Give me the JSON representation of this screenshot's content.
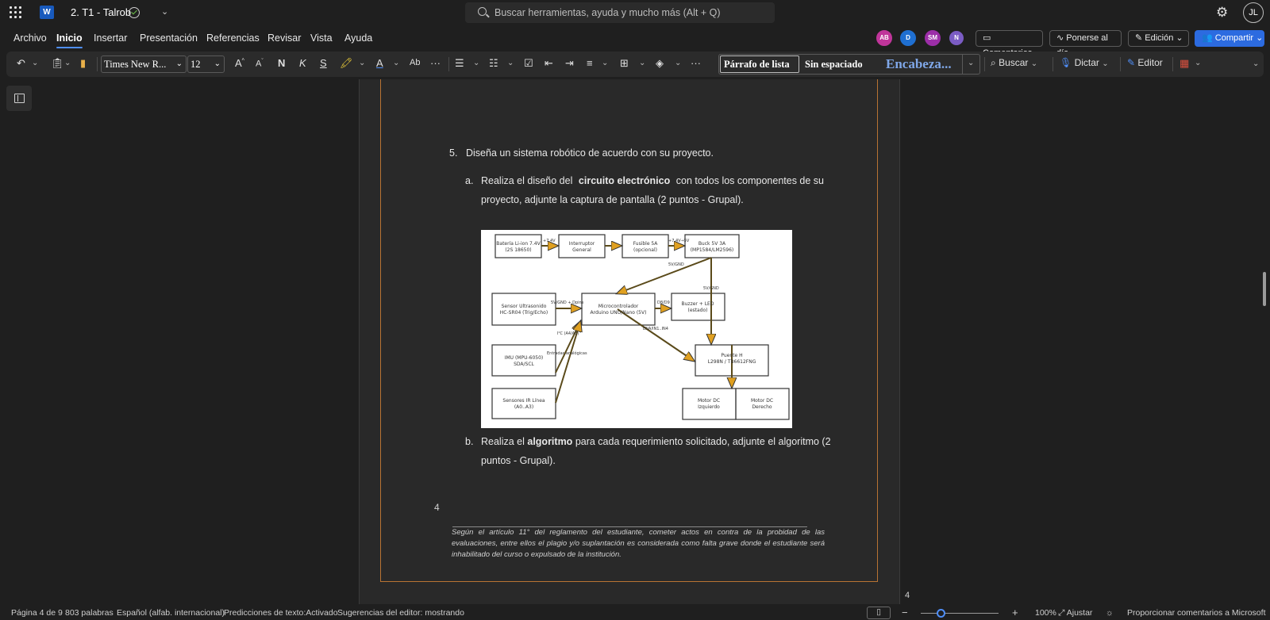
{
  "titlebar": {
    "doc_title": "2. T1 - Talrob",
    "search_placeholder": "Buscar herramientas, ayuda y mucho más (Alt + Q)",
    "user_initials": "JL"
  },
  "menu": {
    "items": [
      "Archivo",
      "Inicio",
      "Insertar",
      "Presentación",
      "Referencias",
      "Revisar",
      "Vista",
      "Ayuda"
    ],
    "active": "Inicio"
  },
  "presence": [
    {
      "initials": "AB",
      "color": "#c0359a"
    },
    {
      "initials": "D",
      "color": "#1f6fd1"
    },
    {
      "initials": "SM",
      "color": "#9c2ea8"
    },
    {
      "initials": "N",
      "color": "#7b5cc4"
    }
  ],
  "header_buttons": {
    "comments": "Comentarios",
    "catch_up": "Ponerse al día",
    "editing": "Edición",
    "share": "Compartir"
  },
  "ribbon": {
    "font_name": "Times New R...",
    "font_size": "12",
    "bold": "N",
    "italic": "K",
    "underline": "S",
    "styles": [
      "Párrafo de lista",
      "Sin espaciado",
      "Encabeza..."
    ],
    "find": "Buscar",
    "dictate": "Dictar",
    "editor": "Editor"
  },
  "document": {
    "q5": "Diseña un sistema robótico de acuerdo con su proyecto.",
    "q5_num": "5.",
    "qa_label": "a.",
    "qa_pre": "Realiza el diseño del",
    "qa_bold": "circuito electrónico",
    "qa_post": "con todos los componentes de su",
    "qa_line2": "proyecto, adjunte la captura de pantalla (2 puntos - Grupal).",
    "qb_label": "b.",
    "qb_pre": "Realiza el",
    "qb_bold": "algoritmo",
    "qb_post": "para cada requerimiento solicitado, adjunte el algoritmo (2",
    "qb_line2": "puntos - Grupal).",
    "page_number": "4",
    "footnote": "Según el artículo 11° del reglamento del estudiante, cometer actos en contra de la probidad de las evaluaciones, entre ellos el plagio y/o suplantación es considerada como falta grave donde el estudiante será inhabilitado del curso o expulsado de la institución."
  },
  "diagram": {
    "blocks": {
      "battery": [
        "Batería Li-ion 7.4V",
        "(2S 18650)"
      ],
      "switch": [
        "Interruptor",
        "General"
      ],
      "fuse": [
        "Fusible 5A",
        "(opcional)"
      ],
      "buck": [
        "Buck 5V 3A",
        "(MP1584/LM2596)"
      ],
      "ultrasonic": [
        "Sensor Ultrasonido",
        "HC-SR04 (Trig/Echo)"
      ],
      "mcu": [
        "Microcontrolador",
        "Arduino UNO/Nano (5V)"
      ],
      "buzzer": [
        "Buzzer + LED",
        "(estado)"
      ],
      "imu": [
        "IMU (MPU-6050)",
        "SDA/SCL"
      ],
      "bridge": [
        "Puente H",
        "L298N / TB6612FNG"
      ],
      "ir": [
        "Sensores IR Línea",
        "(A0..A3)"
      ],
      "motor_left": [
        "Motor DC",
        "Izquierdo"
      ],
      "motor_right": [
        "Motor DC",
        "Derecho"
      ]
    },
    "labels": {
      "v74a": "+7.4V",
      "v74b": "+7.4V→5V",
      "gnd1": "5V/GND",
      "gnd2": "5V/GND",
      "dpins": "5V/GND + Dpins",
      "d8d9": "D8/D9",
      "in": "ENA/IN1..IN4",
      "i2c": "I²C (A4/A5)",
      "analog": "Entradas analógicas"
    }
  },
  "status": {
    "page": "Página 4 de 9",
    "words": "803 palabras",
    "language": "Español (alfab. internacional)",
    "predictions": "Predicciones de texto:Activado",
    "suggestions": "Sugerencias del editor: mostrando",
    "zoom": "100%",
    "fit": "Ajustar",
    "feedback": "Proporcionar comentarios a Microsoft",
    "page_indicator": "4"
  }
}
